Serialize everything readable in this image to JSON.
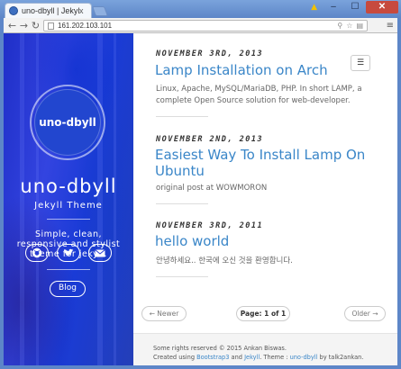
{
  "browser": {
    "tab_title": "uno-dbyll | Jekyll Them",
    "tab_close": "x",
    "url": "161.202.103.101",
    "warning_icon": "warning-icon",
    "window_buttons": [
      "–",
      "☐",
      "✕"
    ]
  },
  "sidebar": {
    "avatar_text": "uno-dbyll",
    "title": "uno-dbyll",
    "subtitle": "Jekyll Theme",
    "tagline": "Simple, clean, responsive and stylist theme for jekyll.",
    "social_icons": [
      "github-icon",
      "twitter-icon",
      "mail-icon"
    ],
    "blog_button": "Blog",
    "accent_color": "#2a3fd4"
  },
  "posts": [
    {
      "date": "NOVEMBER 3RD, 2013",
      "title": "Lamp Installation on Arch",
      "excerpt": "Linux, Apache, MySQL/MariaDB, PHP. In short LAMP, a complete Open Source solution for web-developer."
    },
    {
      "date": "NOVEMBER 2ND, 2013",
      "title": "Easiest Way To Install Lamp On Ubuntu",
      "excerpt": "original post at WOWMORON"
    },
    {
      "date": "NOVEMBER 3RD, 2011",
      "title": "hello world",
      "excerpt": "안녕하세요.. 한국에 오신 것을 환영합니다."
    }
  ],
  "pagination": {
    "newer": "← Newer",
    "current": "Page: 1 of 1",
    "older": "Older →"
  },
  "footer": {
    "line1": "Some rights reserved © 2015 Ankan Biswas.",
    "line2_prefix": "Created using ",
    "bootstrap": "Bootstrap3",
    "and": " and ",
    "jekyll": "Jekyll",
    "theme_label": ". Theme : ",
    "theme": "uno-dbyll",
    "by": " by talk2ankan."
  },
  "colors": {
    "link": "#3a86c8",
    "cover_blue": "#2a3fd4"
  }
}
